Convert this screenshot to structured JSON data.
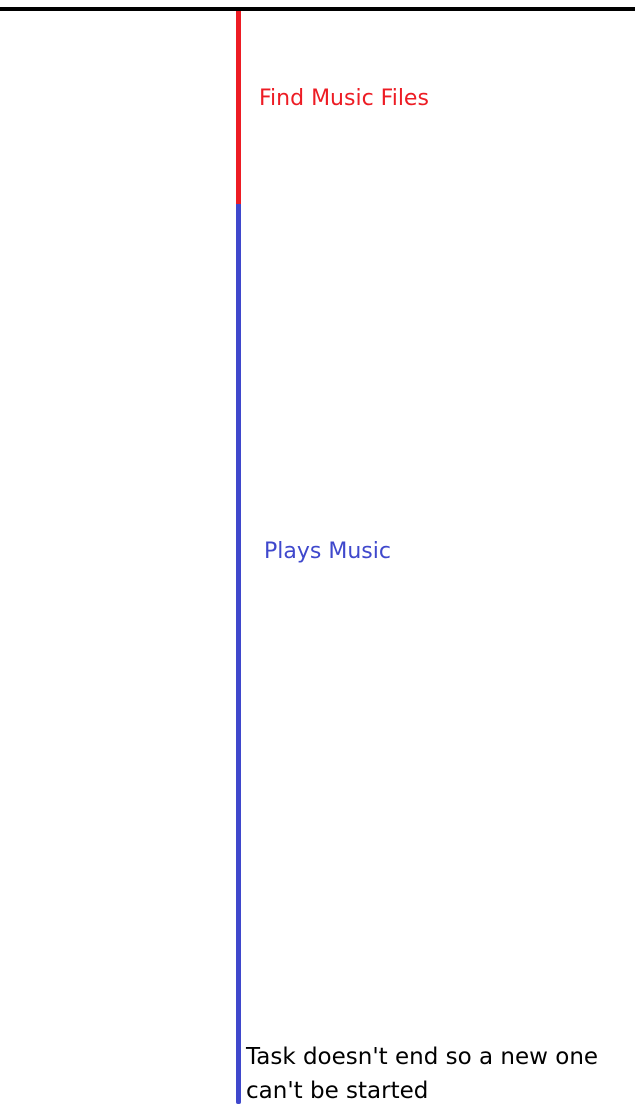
{
  "diagram": {
    "segments": [
      {
        "name": "find-music-files",
        "label": "Find Music Files",
        "color": "#ed1c24"
      },
      {
        "name": "plays-music",
        "label": "Plays Music",
        "color": "#3f48cc"
      }
    ],
    "end_note": "Task doesn't end so a new one can't be started",
    "top_line_color": "#000000"
  }
}
